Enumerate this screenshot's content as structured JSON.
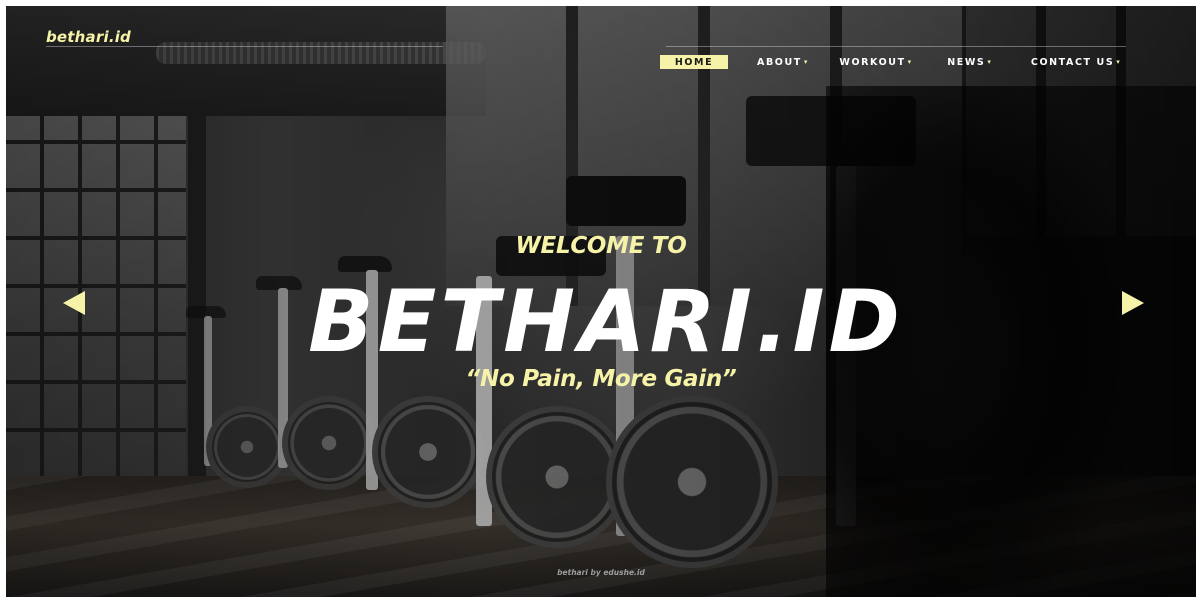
{
  "header": {
    "brand": "bethari.id"
  },
  "nav": {
    "items": [
      {
        "label": "HOME",
        "has_dropdown": false,
        "active": true
      },
      {
        "label": "ABOUT",
        "has_dropdown": true,
        "active": false
      },
      {
        "label": "WORKOUT",
        "has_dropdown": true,
        "active": false
      },
      {
        "label": "NEWS",
        "has_dropdown": true,
        "active": false
      },
      {
        "label": "CONTACT US",
        "has_dropdown": true,
        "active": false
      }
    ],
    "caret": "▾"
  },
  "hero": {
    "welcome": "WELCOME TO",
    "headline": "BETHARI.ID",
    "tagline": "“No Pain, More Gain”",
    "prev_icon": "triangle-left-icon",
    "next_icon": "triangle-right-icon"
  },
  "footer": {
    "credit": "bethari by edushe.id"
  },
  "colors": {
    "accent": "#f6f3a8",
    "text": "#ffffff",
    "background": "#161616"
  }
}
